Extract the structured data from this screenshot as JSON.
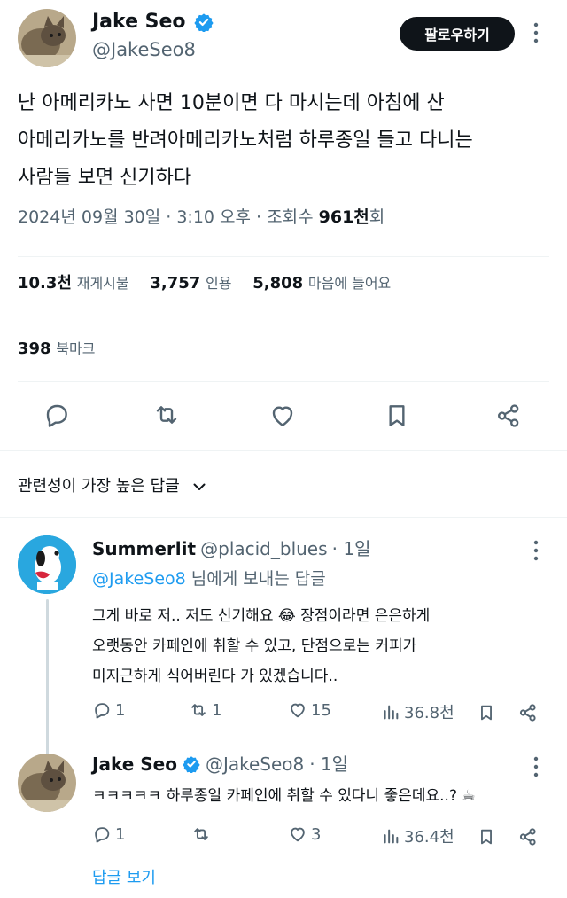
{
  "tweet": {
    "author_name": "Jake Seo",
    "author_handle": "@JakeSeo8",
    "follow_label": "팔로우하기",
    "text_line1": "난 아메리카노 사면 10분이면 다 마시는데 아침에 산",
    "text_line2": "아메리카노를 반려아메리카노처럼 하루종일 들고 다니는",
    "text_line3": "사람들 보면 신기하다",
    "date": "2024년 09월 30일 · 3:10 오후 · 조회수 ",
    "views": "961천",
    "views_suffix": "회",
    "stats": {
      "reposts_num": "10.3천",
      "reposts_lbl": "재게시물",
      "quotes_num": "3,757",
      "quotes_lbl": "인용",
      "likes_num": "5,808",
      "likes_lbl": "마음에 들어요",
      "bookmarks_num": "398",
      "bookmarks_lbl": "북마크"
    }
  },
  "sort": {
    "label": "관련성이 가장 높은 답글"
  },
  "replies": [
    {
      "author_name": "Summerlit",
      "author_handle": "@placid_blues",
      "time": "· 1일",
      "reply_to_handle": "@JakeSeo8",
      "reply_to_suffix": " 님에게 보내는 답글",
      "line1": "그게 바로 저.. 저도 신기해요 😂 장점이라면 은은하게",
      "line2": "오랫동안 카페인에 취할 수 있고, 단점으로는 커피가",
      "line3": "미지근하게 식어버린다 가 있겠습니다..",
      "replies": "1",
      "reposts": "1",
      "likes": "15",
      "views": "36.8천"
    },
    {
      "author_name": "Jake Seo",
      "author_handle": "@JakeSeo8",
      "time": "· 1일",
      "line1": "ㅋㅋㅋㅋㅋ 하루종일 카페인에 취할 수 있다니 좋은데요..? ☕",
      "replies": "1",
      "reposts": "",
      "likes": "3",
      "views": "36.4천",
      "show_replies": "답글 보기"
    }
  ],
  "colors": {
    "accent": "#1d9bf0",
    "text": "#0f1419",
    "muted": "#536471"
  }
}
